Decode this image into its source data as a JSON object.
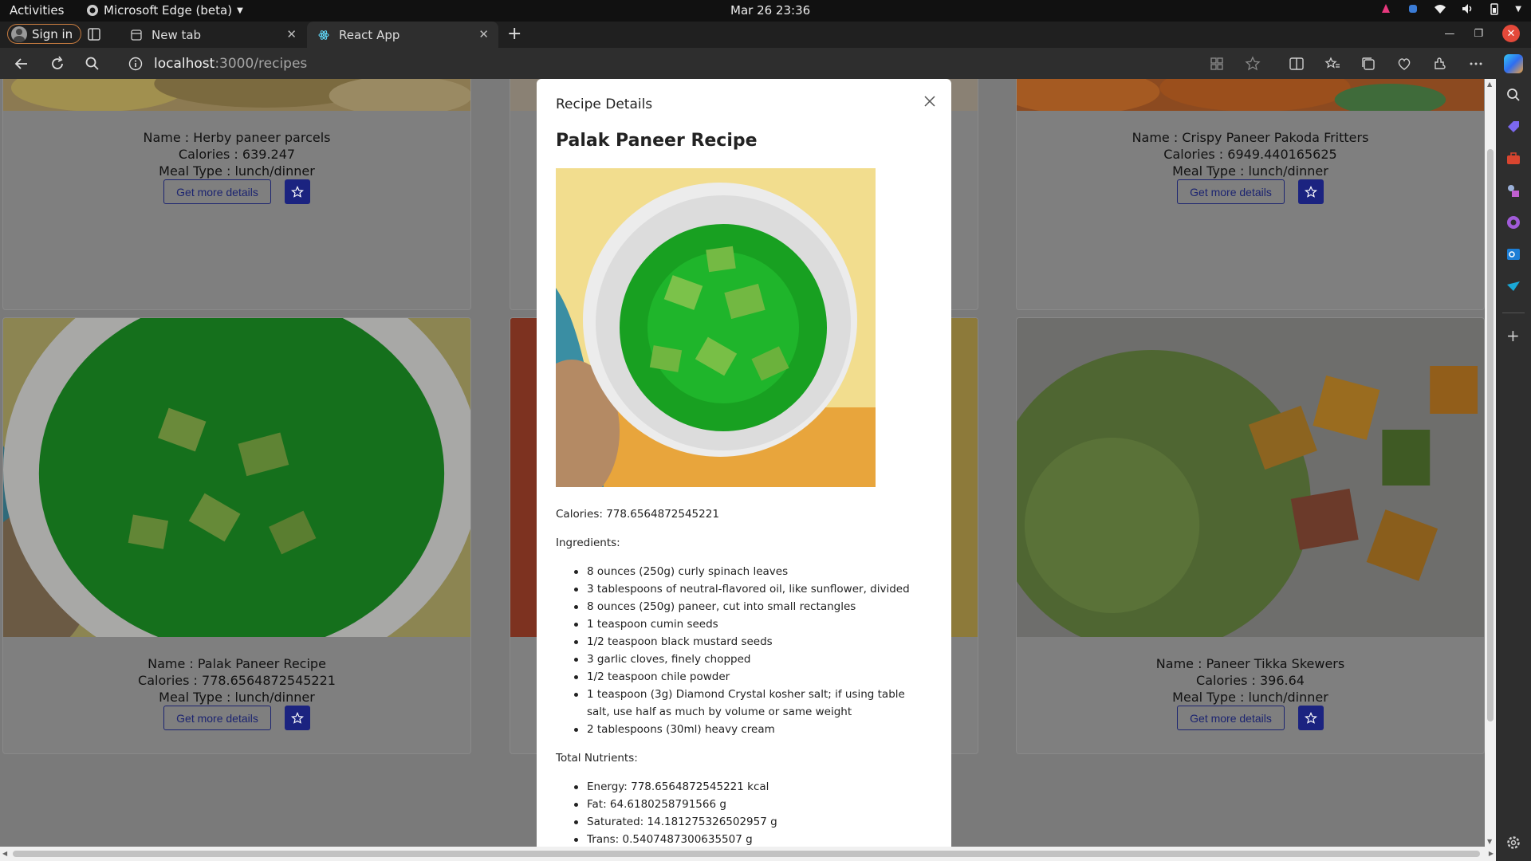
{
  "system": {
    "activities": "Activities",
    "app_name": "Microsoft Edge (beta)",
    "clock": "Mar 26  23:36"
  },
  "browser": {
    "sign_in": "Sign in",
    "tabs": [
      {
        "label": "New tab"
      },
      {
        "label": "React App"
      }
    ],
    "url_host": "localhost",
    "url_path": ":3000/recipes"
  },
  "cards": [
    {
      "name": "Name : Herby paneer parcels",
      "calories": "Calories : 639.247",
      "meal_type": "Meal Type : lunch/dinner",
      "details_label": "Get more details"
    },
    {
      "name": "Name : Crispy Paneer Pakoda Fritters",
      "calories": "Calories : 6949.440165625",
      "meal_type": "Meal Type : lunch/dinner",
      "details_label": "Get more details"
    },
    {
      "name": "Name : Palak Paneer Recipe",
      "calories": "Calories : 778.6564872545221",
      "meal_type": "Meal Type : lunch/dinner",
      "details_label": "Get more details"
    },
    {
      "name": "Name : Paneer Tikka Skewers",
      "calories": "Calories : 396.64",
      "meal_type": "Meal Type : lunch/dinner",
      "details_label": "Get more details"
    }
  ],
  "modal": {
    "header": "Recipe Details",
    "recipe_title": "Palak Paneer Recipe",
    "calories": "Calories: 778.6564872545221",
    "ingredients_label": "Ingredients:",
    "ingredients": [
      "8 ounces (250g) curly spinach leaves",
      "3 tablespoons of neutral-flavored oil, like sunflower, divided",
      "8 ounces (250g) paneer, cut into small rectangles",
      "1 teaspoon cumin seeds",
      "1/2 teaspoon black mustard seeds",
      "3 garlic cloves, finely chopped",
      "1/2 teaspoon chile powder",
      "1 teaspoon (3g) Diamond Crystal kosher salt; if using table salt, use half as much by volume or same weight",
      "2 tablespoons (30ml) heavy cream"
    ],
    "nutrients_label": "Total Nutrients:",
    "nutrients": [
      "Energy: 778.6564872545221 kcal",
      "Fat: 64.6180258791566 g",
      "Saturated: 14.181275326502957 g",
      "Trans: 0.5407487300635507 g"
    ]
  }
}
